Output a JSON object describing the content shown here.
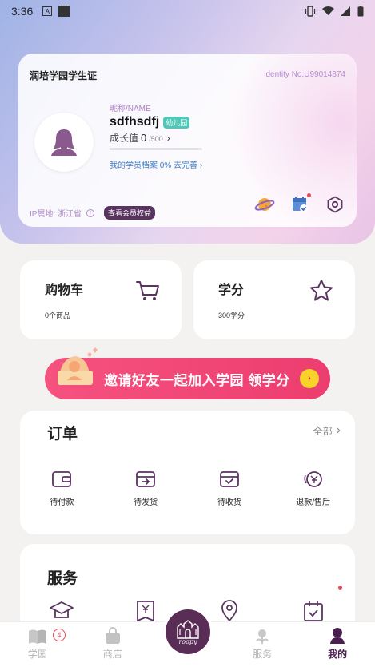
{
  "status_bar": {
    "time": "3:36",
    "notif_icon_letter": "A"
  },
  "card": {
    "title": "润培学园学生证",
    "identity": "identity No.U99014874",
    "nickname_label": "昵称/NAME",
    "nickname": "sdfhsdfj",
    "level_badge": "幼儿园",
    "growth_label": "成长值",
    "growth_current": "0",
    "growth_max": "/500",
    "growth_progress": 0.0,
    "profile_text": "我的学员档案 0% 去完善",
    "ip_text": "IP属地: 浙江省",
    "vip_button": "查看会员权益"
  },
  "tiles": {
    "cart": {
      "title": "购物车",
      "sub": "0个商品"
    },
    "points": {
      "title": "学分",
      "sub": "300学分"
    }
  },
  "invite": {
    "text": "邀请好友一起加入学园 领学分"
  },
  "orders": {
    "title": "订单",
    "all_label": "全部",
    "items": [
      {
        "label": "待付款",
        "icon": "wallet-icon"
      },
      {
        "label": "待发货",
        "icon": "box-arrow-icon"
      },
      {
        "label": "待收货",
        "icon": "box-check-icon"
      },
      {
        "label": "退款/售后",
        "icon": "refund-icon"
      }
    ]
  },
  "services": {
    "title": "服务",
    "icons": [
      "graduation-cap-icon",
      "receipt-icon",
      "location-pin-icon",
      "calendar-check-icon"
    ]
  },
  "tabbar": {
    "tabs": [
      {
        "label": "学园",
        "badge": "4"
      },
      {
        "label": "商店"
      },
      {
        "label": ""
      },
      {
        "label": "服务"
      },
      {
        "label": "我的"
      }
    ],
    "center_word": "roopy"
  },
  "colors": {
    "accent": "#5a2d57",
    "invite": "#ef4574",
    "teal_badge": "#4fc7b9",
    "link": "#3b7cc6"
  }
}
